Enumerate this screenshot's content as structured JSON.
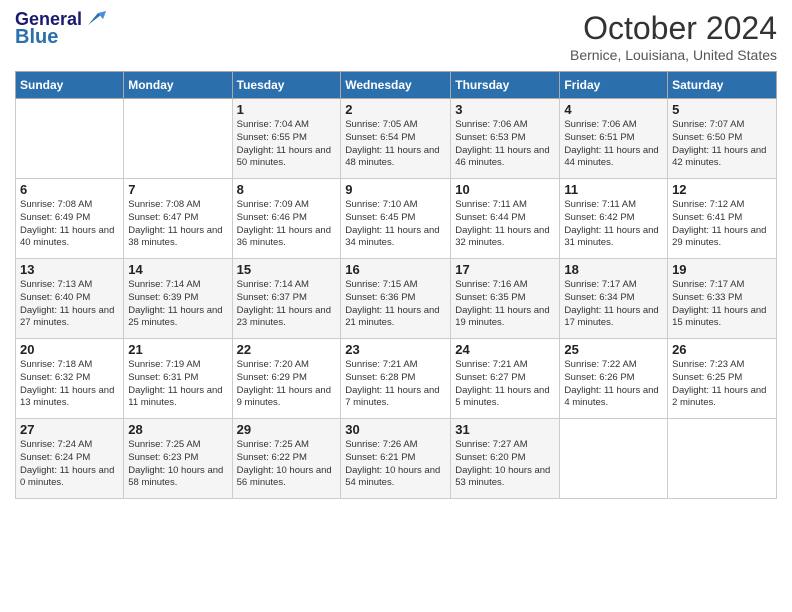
{
  "header": {
    "logo_line1": "General",
    "logo_line2": "Blue",
    "month": "October 2024",
    "location": "Bernice, Louisiana, United States"
  },
  "weekdays": [
    "Sunday",
    "Monday",
    "Tuesday",
    "Wednesday",
    "Thursday",
    "Friday",
    "Saturday"
  ],
  "weeks": [
    [
      {
        "day": "",
        "text": ""
      },
      {
        "day": "",
        "text": ""
      },
      {
        "day": "1",
        "text": "Sunrise: 7:04 AM\nSunset: 6:55 PM\nDaylight: 11 hours and 50 minutes."
      },
      {
        "day": "2",
        "text": "Sunrise: 7:05 AM\nSunset: 6:54 PM\nDaylight: 11 hours and 48 minutes."
      },
      {
        "day": "3",
        "text": "Sunrise: 7:06 AM\nSunset: 6:53 PM\nDaylight: 11 hours and 46 minutes."
      },
      {
        "day": "4",
        "text": "Sunrise: 7:06 AM\nSunset: 6:51 PM\nDaylight: 11 hours and 44 minutes."
      },
      {
        "day": "5",
        "text": "Sunrise: 7:07 AM\nSunset: 6:50 PM\nDaylight: 11 hours and 42 minutes."
      }
    ],
    [
      {
        "day": "6",
        "text": "Sunrise: 7:08 AM\nSunset: 6:49 PM\nDaylight: 11 hours and 40 minutes."
      },
      {
        "day": "7",
        "text": "Sunrise: 7:08 AM\nSunset: 6:47 PM\nDaylight: 11 hours and 38 minutes."
      },
      {
        "day": "8",
        "text": "Sunrise: 7:09 AM\nSunset: 6:46 PM\nDaylight: 11 hours and 36 minutes."
      },
      {
        "day": "9",
        "text": "Sunrise: 7:10 AM\nSunset: 6:45 PM\nDaylight: 11 hours and 34 minutes."
      },
      {
        "day": "10",
        "text": "Sunrise: 7:11 AM\nSunset: 6:44 PM\nDaylight: 11 hours and 32 minutes."
      },
      {
        "day": "11",
        "text": "Sunrise: 7:11 AM\nSunset: 6:42 PM\nDaylight: 11 hours and 31 minutes."
      },
      {
        "day": "12",
        "text": "Sunrise: 7:12 AM\nSunset: 6:41 PM\nDaylight: 11 hours and 29 minutes."
      }
    ],
    [
      {
        "day": "13",
        "text": "Sunrise: 7:13 AM\nSunset: 6:40 PM\nDaylight: 11 hours and 27 minutes."
      },
      {
        "day": "14",
        "text": "Sunrise: 7:14 AM\nSunset: 6:39 PM\nDaylight: 11 hours and 25 minutes."
      },
      {
        "day": "15",
        "text": "Sunrise: 7:14 AM\nSunset: 6:37 PM\nDaylight: 11 hours and 23 minutes."
      },
      {
        "day": "16",
        "text": "Sunrise: 7:15 AM\nSunset: 6:36 PM\nDaylight: 11 hours and 21 minutes."
      },
      {
        "day": "17",
        "text": "Sunrise: 7:16 AM\nSunset: 6:35 PM\nDaylight: 11 hours and 19 minutes."
      },
      {
        "day": "18",
        "text": "Sunrise: 7:17 AM\nSunset: 6:34 PM\nDaylight: 11 hours and 17 minutes."
      },
      {
        "day": "19",
        "text": "Sunrise: 7:17 AM\nSunset: 6:33 PM\nDaylight: 11 hours and 15 minutes."
      }
    ],
    [
      {
        "day": "20",
        "text": "Sunrise: 7:18 AM\nSunset: 6:32 PM\nDaylight: 11 hours and 13 minutes."
      },
      {
        "day": "21",
        "text": "Sunrise: 7:19 AM\nSunset: 6:31 PM\nDaylight: 11 hours and 11 minutes."
      },
      {
        "day": "22",
        "text": "Sunrise: 7:20 AM\nSunset: 6:29 PM\nDaylight: 11 hours and 9 minutes."
      },
      {
        "day": "23",
        "text": "Sunrise: 7:21 AM\nSunset: 6:28 PM\nDaylight: 11 hours and 7 minutes."
      },
      {
        "day": "24",
        "text": "Sunrise: 7:21 AM\nSunset: 6:27 PM\nDaylight: 11 hours and 5 minutes."
      },
      {
        "day": "25",
        "text": "Sunrise: 7:22 AM\nSunset: 6:26 PM\nDaylight: 11 hours and 4 minutes."
      },
      {
        "day": "26",
        "text": "Sunrise: 7:23 AM\nSunset: 6:25 PM\nDaylight: 11 hours and 2 minutes."
      }
    ],
    [
      {
        "day": "27",
        "text": "Sunrise: 7:24 AM\nSunset: 6:24 PM\nDaylight: 11 hours and 0 minutes."
      },
      {
        "day": "28",
        "text": "Sunrise: 7:25 AM\nSunset: 6:23 PM\nDaylight: 10 hours and 58 minutes."
      },
      {
        "day": "29",
        "text": "Sunrise: 7:25 AM\nSunset: 6:22 PM\nDaylight: 10 hours and 56 minutes."
      },
      {
        "day": "30",
        "text": "Sunrise: 7:26 AM\nSunset: 6:21 PM\nDaylight: 10 hours and 54 minutes."
      },
      {
        "day": "31",
        "text": "Sunrise: 7:27 AM\nSunset: 6:20 PM\nDaylight: 10 hours and 53 minutes."
      },
      {
        "day": "",
        "text": ""
      },
      {
        "day": "",
        "text": ""
      }
    ]
  ]
}
